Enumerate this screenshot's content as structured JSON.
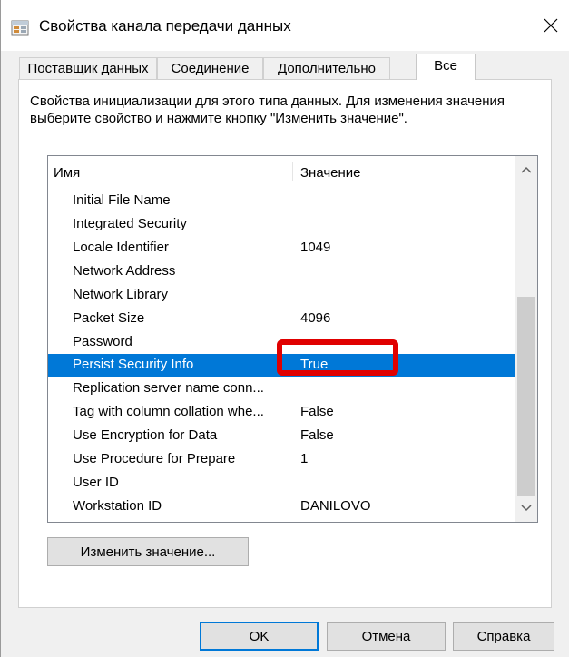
{
  "window": {
    "title": "Свойства канала передачи данных",
    "close_label": "✕"
  },
  "tabs": [
    {
      "label": "Поставщик данных"
    },
    {
      "label": "Соединение"
    },
    {
      "label": "Дополнительно"
    },
    {
      "label": "Все",
      "active": true
    }
  ],
  "description": "Свойства инициализации для этого типа данных. Для изменения значения выберите свойство и нажмите кнопку \"Изменить значение\".",
  "list": {
    "headers": {
      "name": "Имя",
      "value": "Значение"
    },
    "rows": [
      {
        "name": "Initial File Name",
        "value": ""
      },
      {
        "name": "Integrated Security",
        "value": ""
      },
      {
        "name": "Locale Identifier",
        "value": "1049"
      },
      {
        "name": "Network Address",
        "value": ""
      },
      {
        "name": "Network Library",
        "value": ""
      },
      {
        "name": "Packet Size",
        "value": "4096"
      },
      {
        "name": "Password",
        "value": ""
      },
      {
        "name": "Persist Security Info",
        "value": "True",
        "selected": true
      },
      {
        "name": "Replication server name conn...",
        "value": ""
      },
      {
        "name": "Tag with column collation whe...",
        "value": "False"
      },
      {
        "name": "Use Encryption for Data",
        "value": "False"
      },
      {
        "name": "Use Procedure for Prepare",
        "value": "1"
      },
      {
        "name": "User ID",
        "value": ""
      },
      {
        "name": "Workstation ID",
        "value": "DANILOVO"
      }
    ]
  },
  "buttons": {
    "change_value": "Изменить значение...",
    "ok": "OK",
    "cancel": "Отмена",
    "help": "Справка"
  },
  "colors": {
    "selection": "#0078d7",
    "highlight_box": "#e00000"
  },
  "icons": {
    "title": "data-link-icon",
    "close": "close-icon",
    "scroll_up": "chevron-up-icon",
    "scroll_down": "chevron-down-icon"
  }
}
